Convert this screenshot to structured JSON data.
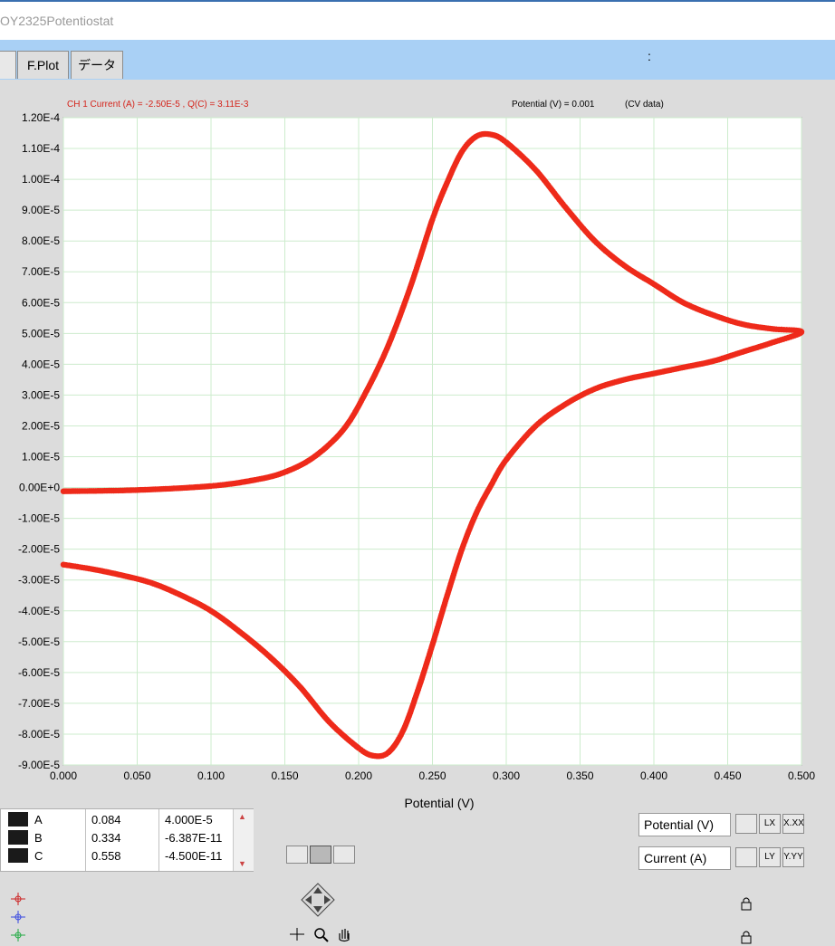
{
  "window": {
    "title": "OY2325Potentiostat"
  },
  "tabs": [
    {
      "label": ""
    },
    {
      "label": "F.Plot"
    },
    {
      "label": "データ"
    }
  ],
  "tabbar_extra": ":",
  "graph": {
    "header_left": "CH 1  Current (A) = -2.50E-5 , Q(C) = 3.11E-3",
    "header_right_label": "Potential (V) =  0.001",
    "header_right_tag": "(CV data)"
  },
  "chart_data": {
    "type": "scatter",
    "xlabel": "Potential (V)",
    "ylabel": "",
    "xlim": [
      0.0,
      0.5
    ],
    "ylim": [
      -9e-05,
      0.00012
    ],
    "x_ticks": [
      "0.000",
      "0.050",
      "0.100",
      "0.150",
      "0.200",
      "0.250",
      "0.300",
      "0.350",
      "0.400",
      "0.450",
      "0.500"
    ],
    "y_ticks": [
      "1.20E-4",
      "1.10E-4",
      "1.00E-4",
      "9.00E-5",
      "8.00E-5",
      "7.00E-5",
      "6.00E-5",
      "5.00E-5",
      "4.00E-5",
      "3.00E-5",
      "2.00E-5",
      "1.00E-5",
      "0.00E+0",
      "-1.00E-5",
      "-2.00E-5",
      "-3.00E-5",
      "-4.00E-5",
      "-5.00E-5",
      "-6.00E-5",
      "-7.00E-5",
      "-8.00E-5",
      "-9.00E-5"
    ],
    "grid": true,
    "series_color": "#ee2a1a",
    "series": [
      {
        "points": [
          [
            0.0,
            -1.2e-06
          ],
          [
            0.05,
            -8e-07
          ],
          [
            0.1,
            5e-07
          ],
          [
            0.13,
            2.5e-06
          ],
          [
            0.15,
            5e-06
          ],
          [
            0.17,
            1e-05
          ],
          [
            0.19,
            1.9e-05
          ],
          [
            0.205,
            3.1e-05
          ],
          [
            0.22,
            4.6e-05
          ],
          [
            0.235,
            6.5e-05
          ],
          [
            0.25,
            8.7e-05
          ],
          [
            0.26,
            9.9e-05
          ],
          [
            0.27,
            0.000109
          ],
          [
            0.28,
            0.000114
          ],
          [
            0.29,
            0.0001145
          ],
          [
            0.3,
            0.000112
          ],
          [
            0.32,
            0.000103
          ],
          [
            0.34,
            9.1e-05
          ],
          [
            0.36,
            8e-05
          ],
          [
            0.38,
            7.2e-05
          ],
          [
            0.4,
            6.6e-05
          ],
          [
            0.42,
            6e-05
          ],
          [
            0.44,
            5.6e-05
          ],
          [
            0.46,
            5.3e-05
          ],
          [
            0.48,
            5.15e-05
          ],
          [
            0.5,
            5.05e-05
          ],
          [
            0.48,
            4.7e-05
          ],
          [
            0.46,
            4.4e-05
          ],
          [
            0.44,
            4.1e-05
          ],
          [
            0.42,
            3.9e-05
          ],
          [
            0.4,
            3.7e-05
          ],
          [
            0.38,
            3.5e-05
          ],
          [
            0.36,
            3.2e-05
          ],
          [
            0.34,
            2.7e-05
          ],
          [
            0.32,
            2e-05
          ],
          [
            0.3,
            9e-06
          ],
          [
            0.29,
            1e-06
          ],
          [
            0.28,
            -8e-06
          ],
          [
            0.27,
            -2e-05
          ],
          [
            0.26,
            -3.5e-05
          ],
          [
            0.25,
            -5.1e-05
          ],
          [
            0.24,
            -6.6e-05
          ],
          [
            0.23,
            -7.9e-05
          ],
          [
            0.22,
            -8.6e-05
          ],
          [
            0.21,
            -8.7e-05
          ],
          [
            0.2,
            -8.45e-05
          ],
          [
            0.18,
            -7.6e-05
          ],
          [
            0.16,
            -6.45e-05
          ],
          [
            0.14,
            -5.5e-05
          ],
          [
            0.12,
            -4.7e-05
          ],
          [
            0.1,
            -4e-05
          ],
          [
            0.08,
            -3.5e-05
          ],
          [
            0.06,
            -3.1e-05
          ],
          [
            0.04,
            -2.85e-05
          ],
          [
            0.02,
            -2.65e-05
          ],
          [
            0.0,
            -2.5e-05
          ]
        ]
      }
    ]
  },
  "cursors": [
    {
      "name": "A",
      "x": "0.084",
      "y": "4.000E-5",
      "color": "#cc2222"
    },
    {
      "name": "B",
      "x": "0.334",
      "y": "-6.387E-11",
      "color": "#2233cc"
    },
    {
      "name": "C",
      "x": "0.558",
      "y": "-4.500E-11",
      "color": "#22aa44"
    }
  ],
  "axis_controls": {
    "x_label": "Potential (V)",
    "y_label": "Current (A)",
    "x_buttons": [
      "LX",
      "X.XX"
    ],
    "y_buttons": [
      "LY",
      "Y.YY"
    ]
  }
}
